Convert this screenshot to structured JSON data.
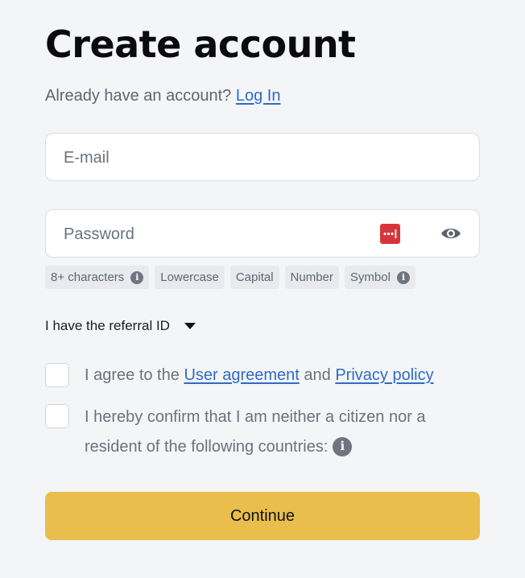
{
  "header": {
    "title": "Create account",
    "already_text": "Already have an account?",
    "login_link": "Log In"
  },
  "form": {
    "email_placeholder": "E-mail",
    "password_placeholder": "Password",
    "password_requirements": [
      "8+ characters",
      "Lowercase",
      "Capital",
      "Number",
      "Symbol"
    ],
    "referral_toggle": "I have the referral ID",
    "agree_prefix": "I agree to the",
    "user_agreement_link": "User agreement",
    "agree_and": "and",
    "privacy_policy_link": "Privacy policy",
    "residency_text": "I hereby confirm that I am neither a citizen nor a resident of the following countries:",
    "continue_label": "Continue"
  },
  "icons": {
    "password_manager": "password-manager-icon",
    "show_password": "eye-icon",
    "info": "info-icon",
    "dropdown": "caret-down-icon"
  },
  "colors": {
    "background": "#f4f5f7",
    "link": "#2f6bc6",
    "button": "#e9be4c",
    "password_manager": "#d8353a"
  }
}
